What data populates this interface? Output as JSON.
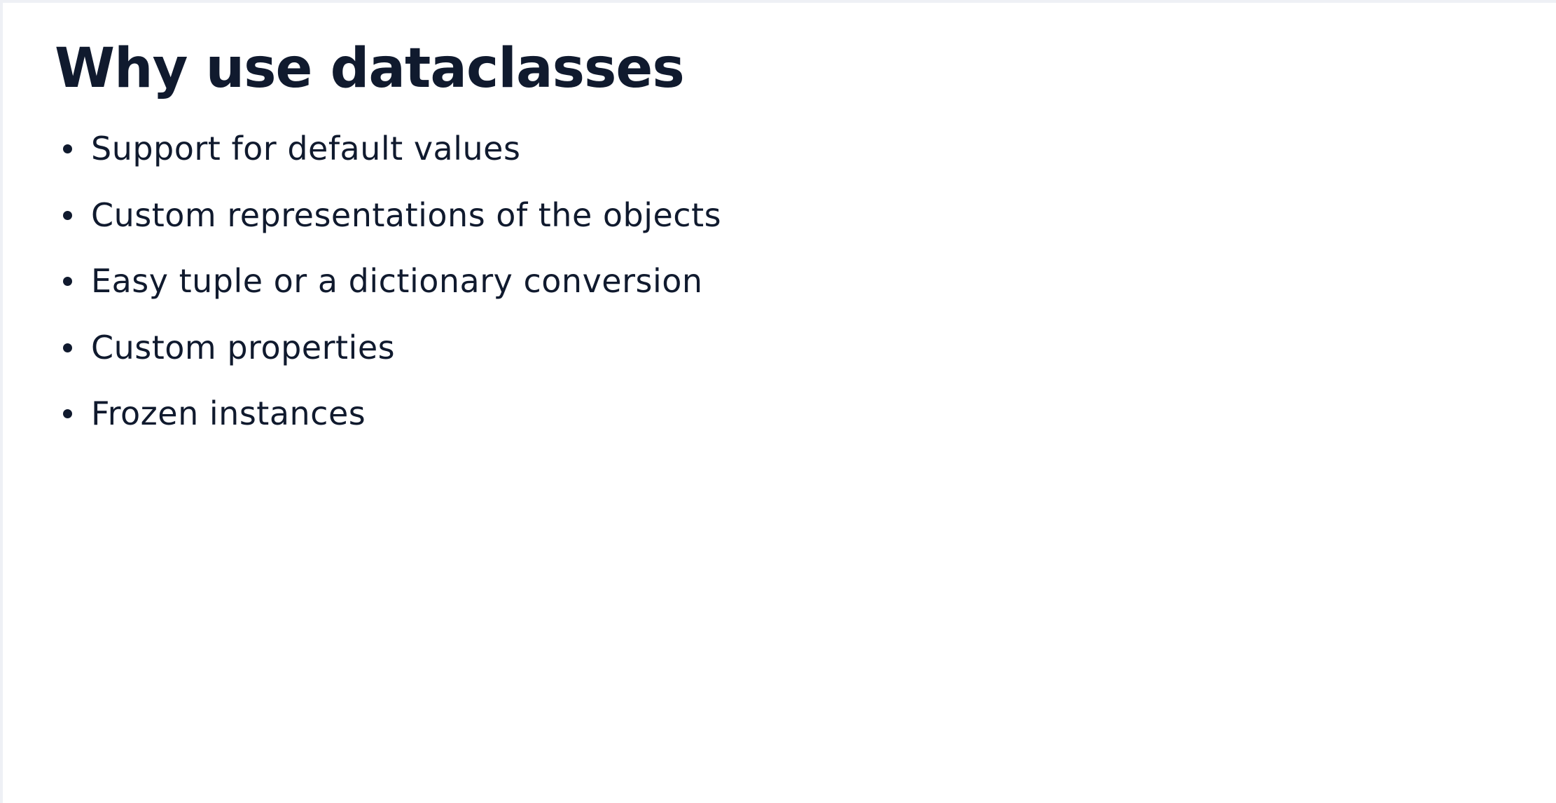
{
  "slide": {
    "title": "Why use dataclasses",
    "bullets": [
      "Support for default values",
      "Custom representations of the objects",
      "Easy tuple or a dictionary conversion",
      "Custom properties",
      "Frozen instances"
    ]
  },
  "colors": {
    "text": "#101a2e",
    "background": "#ffffff",
    "frame": "#eef0f5"
  }
}
